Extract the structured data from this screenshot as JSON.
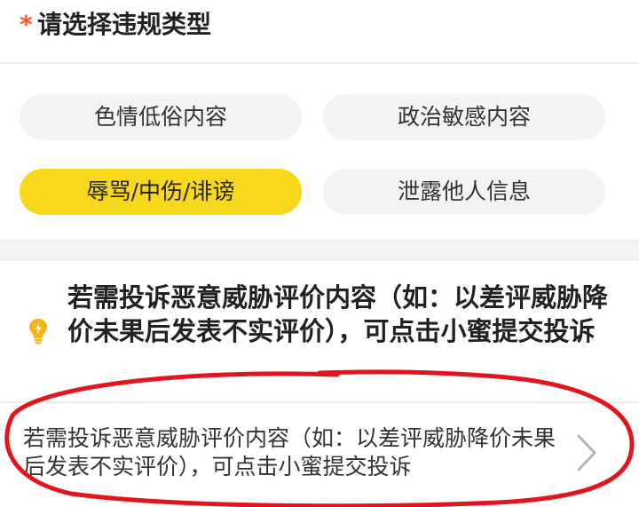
{
  "header": {
    "required_mark": "*",
    "title": "请选择违规类型"
  },
  "options": [
    {
      "label": "色情低俗内容",
      "selected": false
    },
    {
      "label": "政治敏感内容",
      "selected": false
    },
    {
      "label": "辱骂/中伤/诽谤",
      "selected": true
    },
    {
      "label": "泄露他人信息",
      "selected": false
    }
  ],
  "tip": {
    "icon": "lightbulb-icon",
    "text": "若需投诉恶意威胁评价内容（如：以差评威胁降价未果后发表不实评价），可点击小蜜提交投诉"
  },
  "link": {
    "text": "若需投诉恶意威胁评价内容（如：以差评威胁降价未果后发表不实评价），可点击小蜜提交投诉",
    "icon": "chevron-right-icon"
  },
  "colors": {
    "accent": "#f8d81c",
    "required_star": "#ff5722",
    "bulb": "#f5b417",
    "annotation_ring": "#e3141c"
  }
}
